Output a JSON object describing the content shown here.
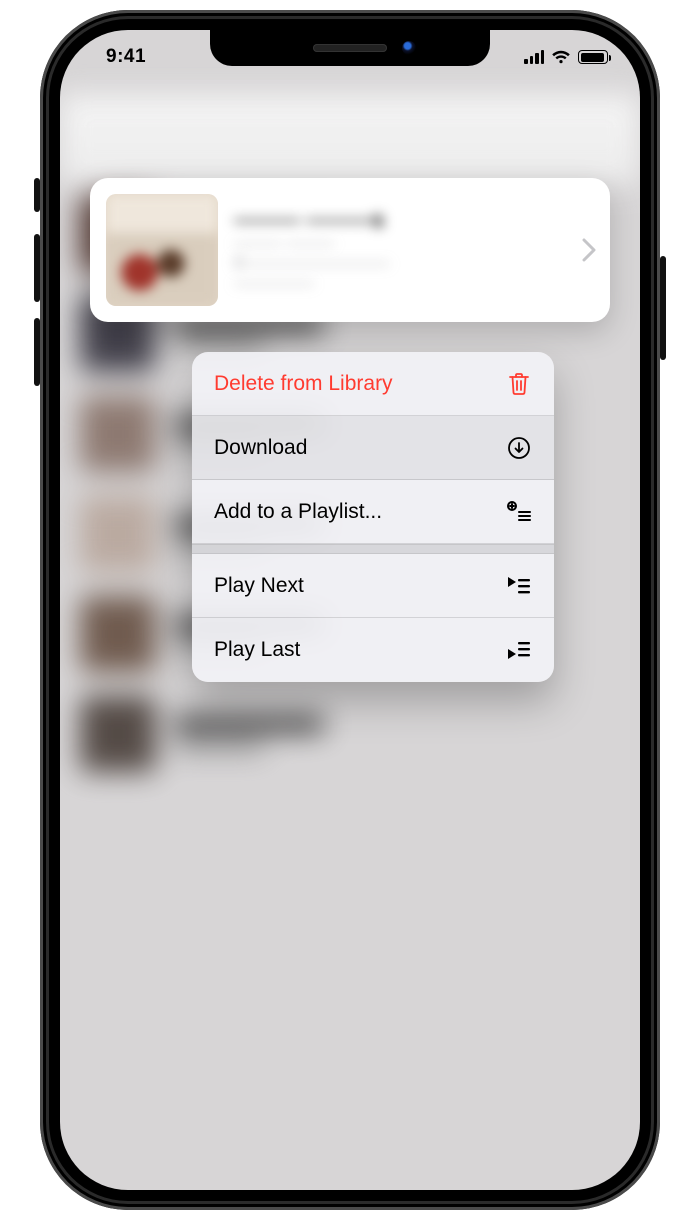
{
  "status_bar": {
    "time": "9:41"
  },
  "card": {
    "title": "——— ———s",
    "line1": "——— ———",
    "line2": "C—————————",
    "line3": "—————"
  },
  "menu": {
    "items": [
      {
        "label": "Delete from Library",
        "icon": "trash-icon",
        "destructive": true
      },
      {
        "label": "Download",
        "icon": "download-circle-icon",
        "highlight": true
      },
      {
        "label": "Add to a Playlist...",
        "icon": "add-to-playlist-icon"
      },
      {
        "label": "Play Next",
        "icon": "play-next-icon",
        "sep_before": true
      },
      {
        "label": "Play Last",
        "icon": "play-last-icon"
      }
    ]
  }
}
